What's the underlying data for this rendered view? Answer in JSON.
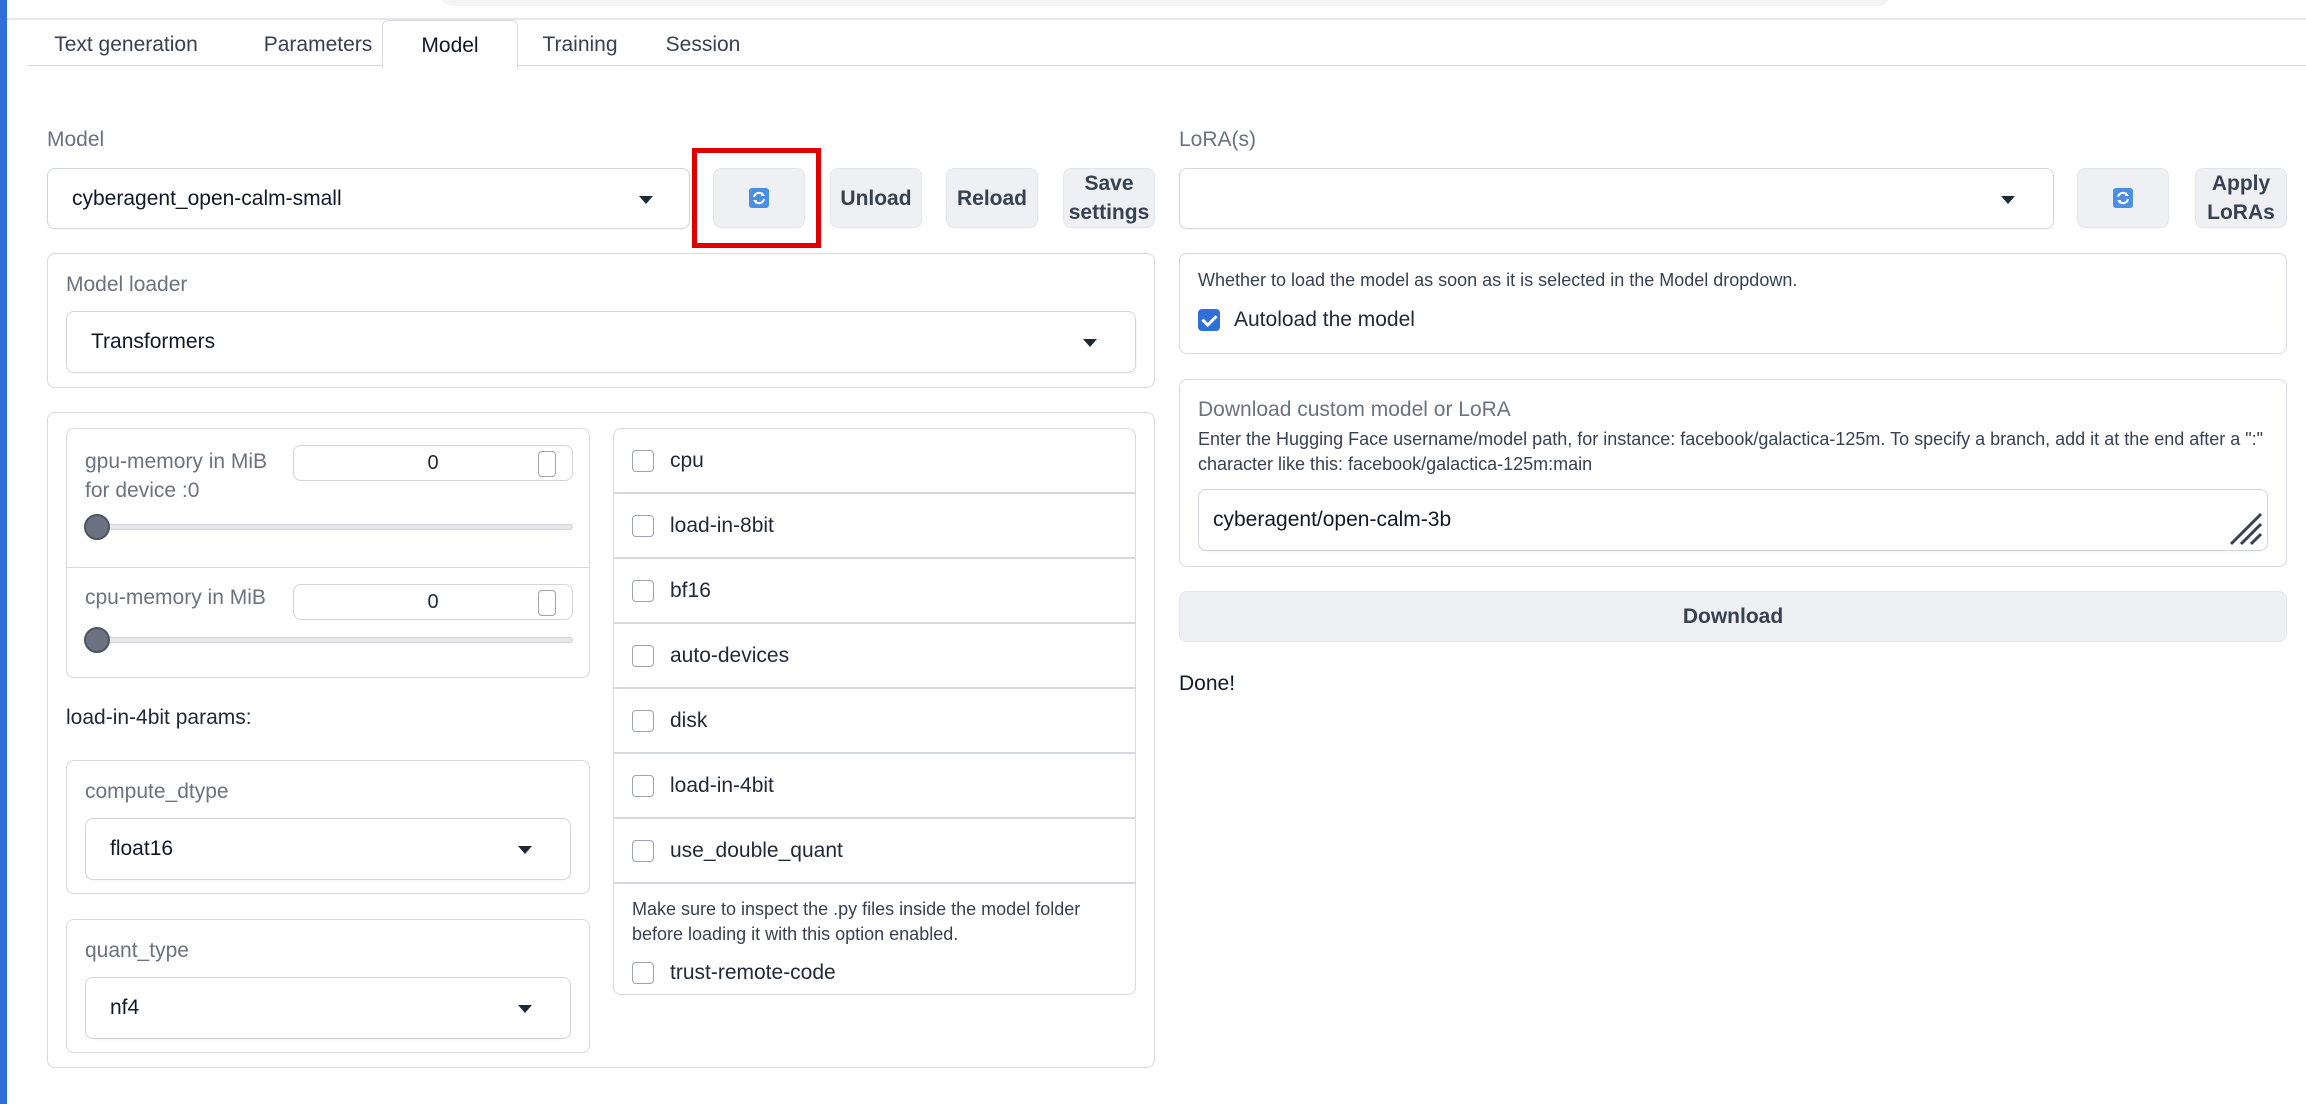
{
  "tabs": [
    "Text generation",
    "Parameters",
    "Model",
    "Training",
    "Session"
  ],
  "active_tab": "Model",
  "model": {
    "label": "Model",
    "selected": "cyberagent_open-calm-small",
    "unload_label": "Unload",
    "reload_label": "Reload",
    "save_label_line1": "Save",
    "save_label_line2": "settings"
  },
  "lora": {
    "label": "LoRA(s)",
    "selected": "",
    "apply_label_line1": "Apply",
    "apply_label_line2": "LoRAs"
  },
  "loader": {
    "label": "Model loader",
    "selected": "Transformers"
  },
  "gpu_memory": {
    "label_line1": "gpu-memory in MiB",
    "label_line2": "for device :0",
    "value": "0",
    "slider_fraction": 0
  },
  "cpu_memory": {
    "label": "cpu-memory in MiB",
    "value": "0",
    "slider_fraction": 0
  },
  "four_bit": {
    "heading": "load-in-4bit params:",
    "compute_dtype_label": "compute_dtype",
    "compute_dtype_value": "float16",
    "quant_type_label": "quant_type",
    "quant_type_value": "nf4"
  },
  "checkboxes": [
    {
      "label": "cpu",
      "checked": false
    },
    {
      "label": "load-in-8bit",
      "checked": false
    },
    {
      "label": "bf16",
      "checked": false
    },
    {
      "label": "auto-devices",
      "checked": false
    },
    {
      "label": "disk",
      "checked": false
    },
    {
      "label": "load-in-4bit",
      "checked": false
    },
    {
      "label": "use_double_quant",
      "checked": false
    }
  ],
  "trust_remote": {
    "info_line1": "Make sure to inspect the .py files inside the model folder",
    "info_line2": "before loading it with this option enabled.",
    "label": "trust-remote-code",
    "checked": false
  },
  "autoload": {
    "info": "Whether to load the model as soon as it is selected in the Model dropdown.",
    "label": "Autoload the model",
    "checked": true
  },
  "download": {
    "title": "Download custom model or LoRA",
    "info_line1": "Enter the Hugging Face username/model path, for instance: facebook/galactica-125m. To specify a branch, add it at the end after a \":\"",
    "info_line2": "character like this: facebook/galactica-125m:main",
    "input_value": "cyberagent/open-calm-3b",
    "button_label": "Download",
    "status": "Done!"
  },
  "colors": {
    "accent": "#2f6fd9",
    "highlight_box": "#e00000"
  }
}
